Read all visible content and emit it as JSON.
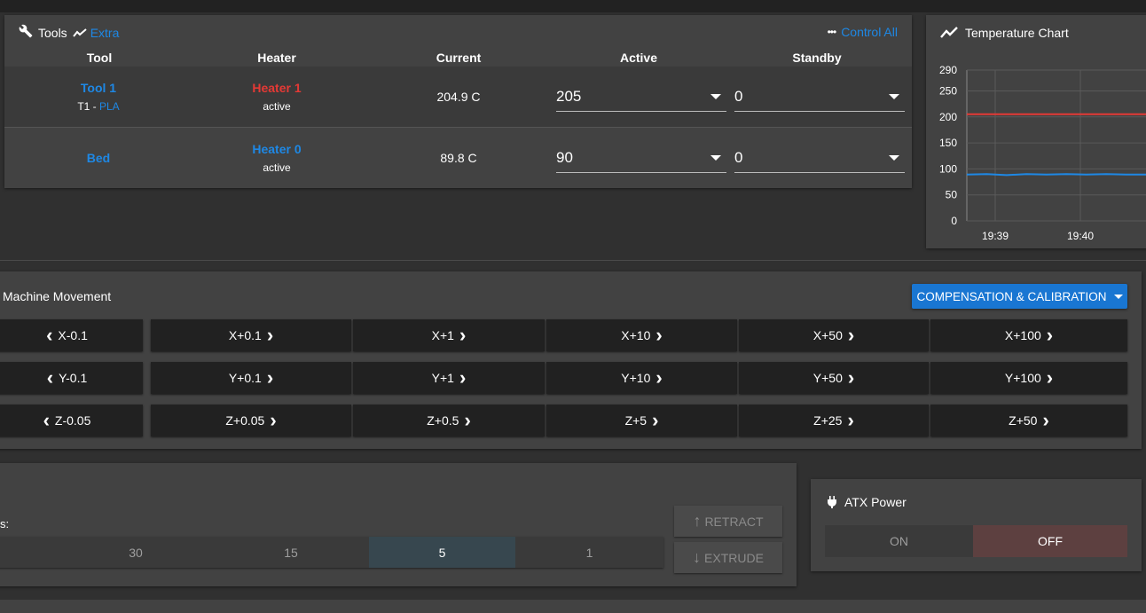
{
  "tools_panel": {
    "title": "Tools",
    "extra_label": "Extra",
    "control_all_label": "Control All",
    "columns": [
      "Tool",
      "Heater",
      "Current",
      "Active",
      "Standby"
    ],
    "rows": [
      {
        "tool": "Tool 1",
        "tool_sub_prefix": "T1 - ",
        "tool_sub_filament": "PLA",
        "heater": "Heater 1",
        "heater_state": "active",
        "current": "204.9 C",
        "active": "205",
        "standby": "0"
      },
      {
        "tool": "Bed",
        "heater": "Heater 0",
        "heater_state": "active",
        "current": "89.8 C",
        "active": "90",
        "standby": "0"
      }
    ]
  },
  "chart_card": {
    "title": "Temperature Chart"
  },
  "chart_data": {
    "type": "line",
    "ylim": [
      0,
      290
    ],
    "y_ticks": [
      "290",
      "250",
      "200",
      "150",
      "100",
      "50",
      "0"
    ],
    "x_ticks": [
      "19:39",
      "19:40"
    ],
    "grid": true,
    "series": [
      {
        "color": "#e53935",
        "values": [
          205,
          205,
          205,
          205,
          205,
          205,
          205,
          205,
          205,
          205
        ]
      },
      {
        "color": "#1e88e5",
        "values": [
          89,
          90,
          88,
          90,
          89,
          90,
          89,
          90,
          89,
          89
        ]
      }
    ]
  },
  "movement": {
    "title": "Machine Movement",
    "compensation_label": "COMPENSATION & CALIBRATION",
    "rows": [
      {
        "neg": "X-0.1",
        "pos": [
          "X+0.1",
          "X+1",
          "X+10",
          "X+50",
          "X+100"
        ]
      },
      {
        "neg": "Y-0.1",
        "pos": [
          "Y+0.1",
          "Y+1",
          "Y+10",
          "Y+50",
          "Y+100"
        ]
      },
      {
        "neg": "Z-0.05",
        "pos": [
          "Z+0.05",
          "Z+0.5",
          "Z+5",
          "Z+25",
          "Z+50"
        ]
      }
    ]
  },
  "extrusion": {
    "amounts_label": "s:",
    "amounts": [
      "30",
      "15",
      "5",
      "1"
    ],
    "selected_amount": "5",
    "retract_label": "RETRACT",
    "extrude_label": "EXTRUDE"
  },
  "atx": {
    "title": "ATX Power",
    "on_label": "ON",
    "off_label": "OFF"
  },
  "colors": {
    "accent_blue": "#1e88e5",
    "heater_red": "#e53935",
    "button_blue": "#1976d2"
  }
}
